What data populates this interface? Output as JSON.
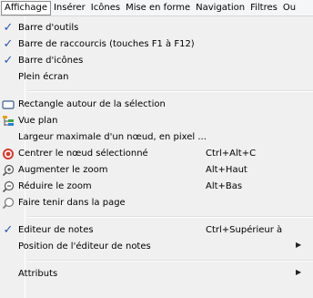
{
  "menubar": {
    "items": [
      "Affichage",
      "Insérer",
      "Icônes",
      "Mise en forme",
      "Navigation",
      "Filtres",
      "Ou"
    ]
  },
  "menu": {
    "items": [
      {
        "label": "Barre d'outils",
        "checked": true
      },
      {
        "label": "Barre de raccourcis (touches F1 à F12)",
        "checked": true
      },
      {
        "label": "Barre d'icônes",
        "checked": true
      },
      {
        "label": "Plein écran"
      },
      {
        "label": "Rectangle autour de la sélection",
        "icon": "rectangle-icon"
      },
      {
        "label": "Vue plan",
        "icon": "outline-view-icon"
      },
      {
        "label": "Largeur maximale d'un nœud, en pixel ..."
      },
      {
        "label": "Centrer le nœud sélectionné",
        "icon": "target-icon",
        "shortcut": "Ctrl+Alt+C"
      },
      {
        "label": "Augmenter le zoom",
        "icon": "zoom-in-icon",
        "shortcut": "Alt+Haut"
      },
      {
        "label": "Réduire le zoom",
        "icon": "zoom-out-icon",
        "shortcut": "Alt+Bas"
      },
      {
        "label": "Faire tenir dans la page",
        "icon": "zoom-fit-icon"
      },
      {
        "label": "Editeur de notes",
        "checked": true,
        "shortcut": "Ctrl+Supérieur à"
      },
      {
        "label": "Position de l'éditeur de notes",
        "submenu": true
      },
      {
        "label": "Attributs",
        "submenu": true
      }
    ]
  }
}
